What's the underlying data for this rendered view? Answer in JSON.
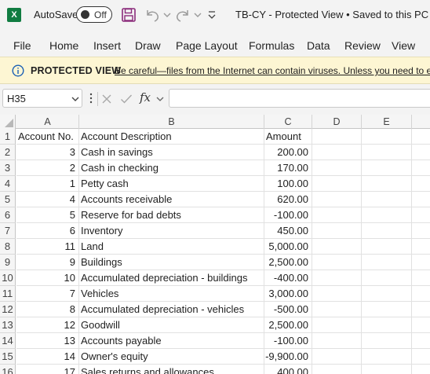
{
  "app": {
    "logo_letter": "X",
    "autosave_label": "AutoSave",
    "autosave_state": "Off",
    "document_title": "TB-CY  -  Protected View • Saved to this PC ∨"
  },
  "ribbon": {
    "tabs": [
      "File",
      "Home",
      "Insert",
      "Draw",
      "Page Layout",
      "Formulas",
      "Data",
      "Review",
      "View"
    ]
  },
  "protected_view": {
    "title": "PROTECTED VIEW",
    "message": "Be careful—files from the Internet can contain viruses. Unless you need to edit"
  },
  "formula_bar": {
    "name_box": "H35",
    "fx_label": "fx",
    "formula": ""
  },
  "columns": [
    "A",
    "B",
    "C",
    "D",
    "E"
  ],
  "rows": [
    {
      "n": "1",
      "a": "Account No.",
      "b": "Account Description",
      "c": "Amount"
    },
    {
      "n": "2",
      "a": "3",
      "b": "Cash in savings",
      "c": "200.00"
    },
    {
      "n": "3",
      "a": "2",
      "b": "Cash in checking",
      "c": "170.00"
    },
    {
      "n": "4",
      "a": "1",
      "b": "Petty cash",
      "c": "100.00"
    },
    {
      "n": "5",
      "a": "4",
      "b": "Accounts receivable",
      "c": "620.00"
    },
    {
      "n": "6",
      "a": "5",
      "b": "Reserve for bad debts",
      "c": "-100.00"
    },
    {
      "n": "7",
      "a": "6",
      "b": "Inventory",
      "c": "450.00"
    },
    {
      "n": "8",
      "a": "11",
      "b": "Land",
      "c": "5,000.00"
    },
    {
      "n": "9",
      "a": "9",
      "b": "Buildings",
      "c": "2,500.00"
    },
    {
      "n": "10",
      "a": "10",
      "b": "Accumulated depreciation - buildings",
      "c": "-400.00"
    },
    {
      "n": "11",
      "a": "7",
      "b": "Vehicles",
      "c": "3,000.00"
    },
    {
      "n": "12",
      "a": "8",
      "b": "Accumulated depreciation - vehicles",
      "c": "-500.00"
    },
    {
      "n": "13",
      "a": "12",
      "b": "Goodwill",
      "c": "2,500.00"
    },
    {
      "n": "14",
      "a": "13",
      "b": "Accounts payable",
      "c": "-100.00"
    },
    {
      "n": "15",
      "a": "14",
      "b": "Owner's equity",
      "c": "-9,900.00"
    },
    {
      "n": "16",
      "a": "17",
      "b": "Sales returns and allowances",
      "c": "400.00"
    }
  ],
  "colors": {
    "excel_green": "#107c41",
    "save_icon": "#8a2a7a",
    "protected_bar_bg": "#fdf6d3",
    "chrome_bg": "#f3f3f3"
  }
}
